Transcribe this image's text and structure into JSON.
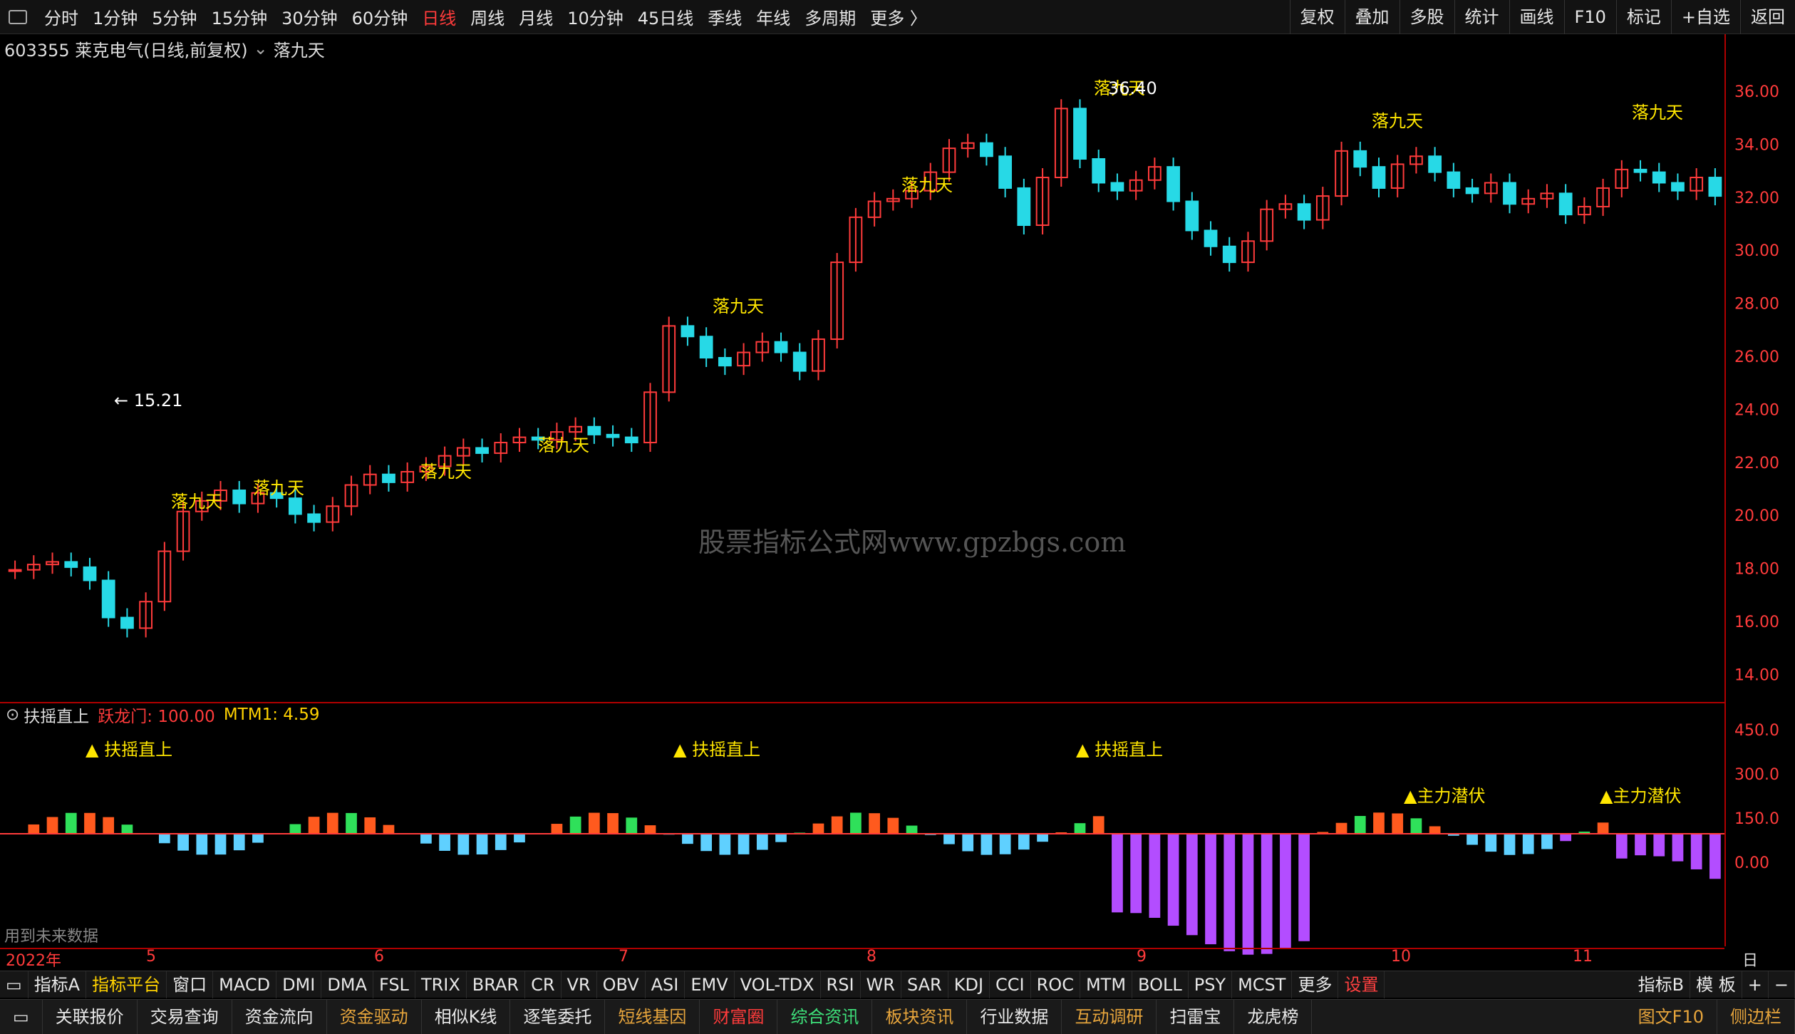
{
  "toolbar": {
    "timeframes": [
      "分时",
      "1分钟",
      "5分钟",
      "15分钟",
      "30分钟",
      "60分钟",
      "日线",
      "周线",
      "月线",
      "10分钟",
      "45日线",
      "季线",
      "年线",
      "多周期",
      "更多 〉"
    ],
    "active": "日线",
    "tools": [
      "复权",
      "叠加",
      "多股",
      "统计",
      "画线",
      "F10",
      "标记",
      "+自选",
      "返回"
    ]
  },
  "chart": {
    "stock_title": "603355 莱克电气(日线,前复权)",
    "indicator": "落九天"
  },
  "indicator_panel": {
    "name": "扶摇直上",
    "val1_label": "跃龙门: 100.00",
    "val2_label": "MTM1: 4.59",
    "future_note": "用到未来数据"
  },
  "price_axis": [
    "36.00",
    "34.00",
    "32.00",
    "30.00",
    "28.00",
    "26.00",
    "24.00",
    "22.00",
    "20.00",
    "18.00",
    "16.00",
    "14.00"
  ],
  "ind_axis": [
    "450.0",
    "300.0",
    "150.0",
    "0.00"
  ],
  "date_axis": {
    "year": "2022年",
    "months": [
      "5",
      "6",
      "7",
      "8",
      "9",
      "10",
      "11"
    ],
    "period": "日线"
  },
  "labels": {
    "high": "36.40",
    "low": "15.21",
    "jtd": "落九天",
    "fy": "扶摇直上",
    "zl": "主力潜伏",
    "watermark": "股票指标公式网www.gpzbgs.com"
  },
  "tabs": [
    "指标A",
    "指标平台",
    "窗口",
    "MACD",
    "DMI",
    "DMA",
    "FSL",
    "TRIX",
    "BRAR",
    "CR",
    "VR",
    "OBV",
    "ASI",
    "EMV",
    "VOL-TDX",
    "RSI",
    "WR",
    "SAR",
    "KDJ",
    "CCI",
    "ROC",
    "MTM",
    "BOLL",
    "PSY",
    "MCST",
    "更多",
    "设置"
  ],
  "tabs_right": [
    "指标B",
    "模 板",
    "+",
    "−"
  ],
  "bottom": [
    "关联报价",
    "交易查询",
    "资金流向",
    "资金驱动",
    "相似K线",
    "逐笔委托",
    "短线基因",
    "财富圈",
    "综合资讯",
    "板块资讯",
    "行业数据",
    "互动调研",
    "扫雷宝",
    "龙虎榜"
  ],
  "bottom_right": [
    "图文F10",
    "侧边栏"
  ],
  "colors": {
    "up": "#ff3b3b",
    "down": "#27d9e6",
    "signal": "#ffe600"
  }
}
